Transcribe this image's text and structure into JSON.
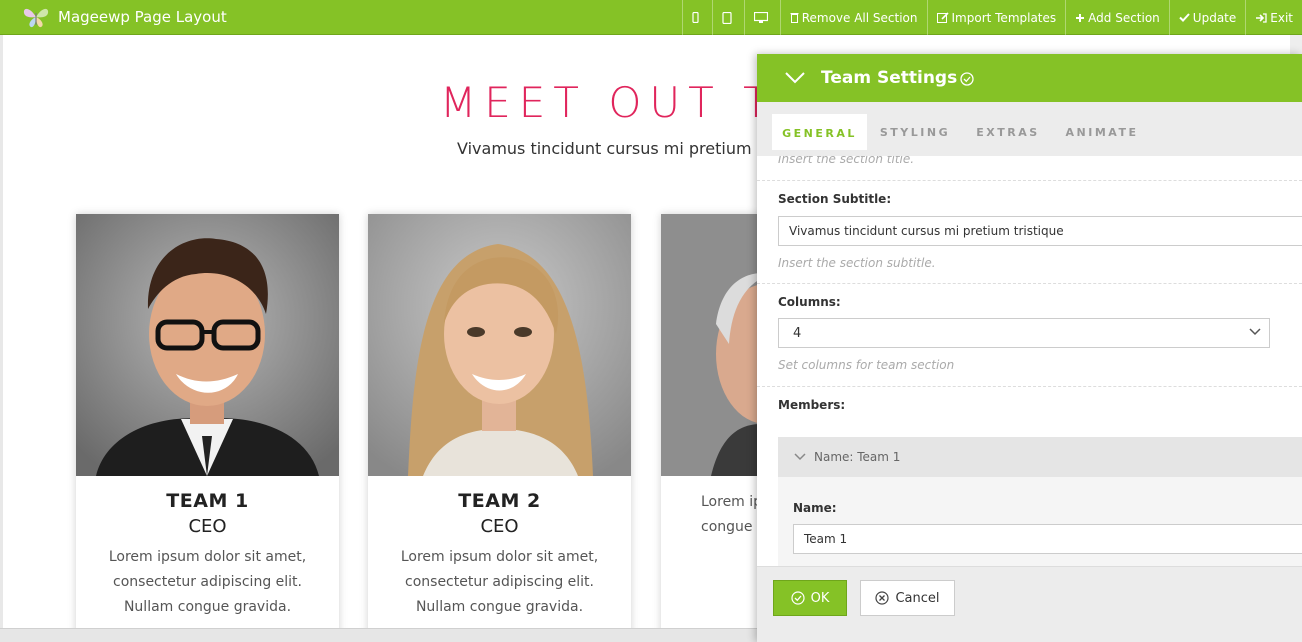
{
  "topbar": {
    "title": "Mageewp Page Layout",
    "remove_all_label": "Remove All Section",
    "import_label": "Import Templates",
    "add_section_label": "Add Section",
    "update_label": "Update",
    "exit_label": "Exit",
    "icons": [
      "mobile-icon",
      "tablet-icon",
      "desktop-icon",
      "trash-icon",
      "edit-icon",
      "plus-icon",
      "check-icon",
      "sign-out-icon"
    ]
  },
  "page": {
    "title": "MEET OUT TE",
    "subtitle": "Vivamus tincidunt cursus mi pretium",
    "title_color": "#e0255c",
    "cards": [
      {
        "name": "TEAM 1",
        "role": "CEO",
        "desc": "Lorem ipsum dolor sit amet, consectetur adipiscing elit. Nullam congue gravida."
      },
      {
        "name": "TEAM 2",
        "role": "CEO",
        "desc": "Lorem ipsum dolor sit amet, consectetur adipiscing elit. Nullam congue gravida."
      },
      {
        "name": "",
        "role": "",
        "desc": "Lorem ip consectetur a congue gravi"
      }
    ]
  },
  "panel": {
    "title": "Team Settings",
    "accent_color": "#85c226",
    "tabs": [
      "GENERAL",
      "STYLING",
      "EXTRAS",
      "ANIMATE"
    ],
    "title_hint": "Insert the section title.",
    "subtitle_label": "Section Subtitle:",
    "subtitle_value": "Vivamus tincidunt cursus mi pretium tristique",
    "subtitle_hint": "Insert the section subtitle.",
    "columns_label": "Columns:",
    "columns_value": "4",
    "columns_hint": "Set columns for team section",
    "members_label": "Members:",
    "member_head": "Name: Team 1",
    "member_name_label": "Name:",
    "member_name_value": "Team 1",
    "ok_label": "OK",
    "cancel_label": "Cancel"
  }
}
